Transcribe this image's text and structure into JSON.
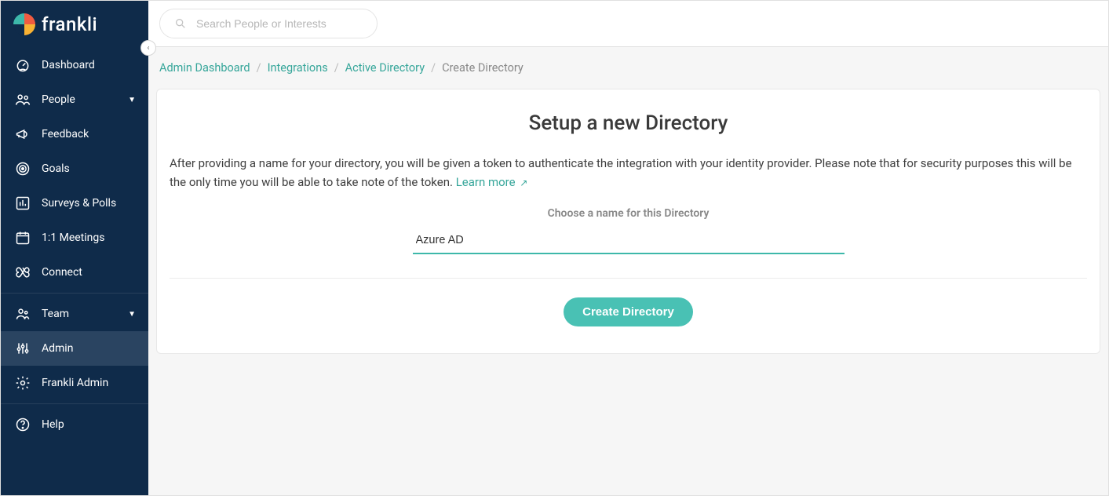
{
  "brand": {
    "name": "frankli"
  },
  "search": {
    "placeholder": "Search People or Interests",
    "value": ""
  },
  "sidebar": {
    "items": [
      {
        "label": "Dashboard"
      },
      {
        "label": "People"
      },
      {
        "label": "Feedback"
      },
      {
        "label": "Goals"
      },
      {
        "label": "Surveys & Polls"
      },
      {
        "label": "1:1 Meetings"
      },
      {
        "label": "Connect"
      },
      {
        "label": "Team"
      },
      {
        "label": "Admin"
      },
      {
        "label": "Frankli Admin"
      },
      {
        "label": "Help"
      }
    ]
  },
  "breadcrumb": {
    "items": [
      {
        "label": "Admin Dashboard"
      },
      {
        "label": "Integrations"
      },
      {
        "label": "Active Directory"
      }
    ],
    "current": "Create Directory"
  },
  "card": {
    "title": "Setup a new Directory",
    "description": "After providing a name for your directory, you will be given a token to authenticate the integration with your identity provider. Please note that for security purposes this will be the only time you will be able to take note of the token. ",
    "learn_more": "Learn more",
    "field_label": "Choose a name for this Directory",
    "field_value": "Azure AD",
    "submit_label": "Create Directory"
  }
}
